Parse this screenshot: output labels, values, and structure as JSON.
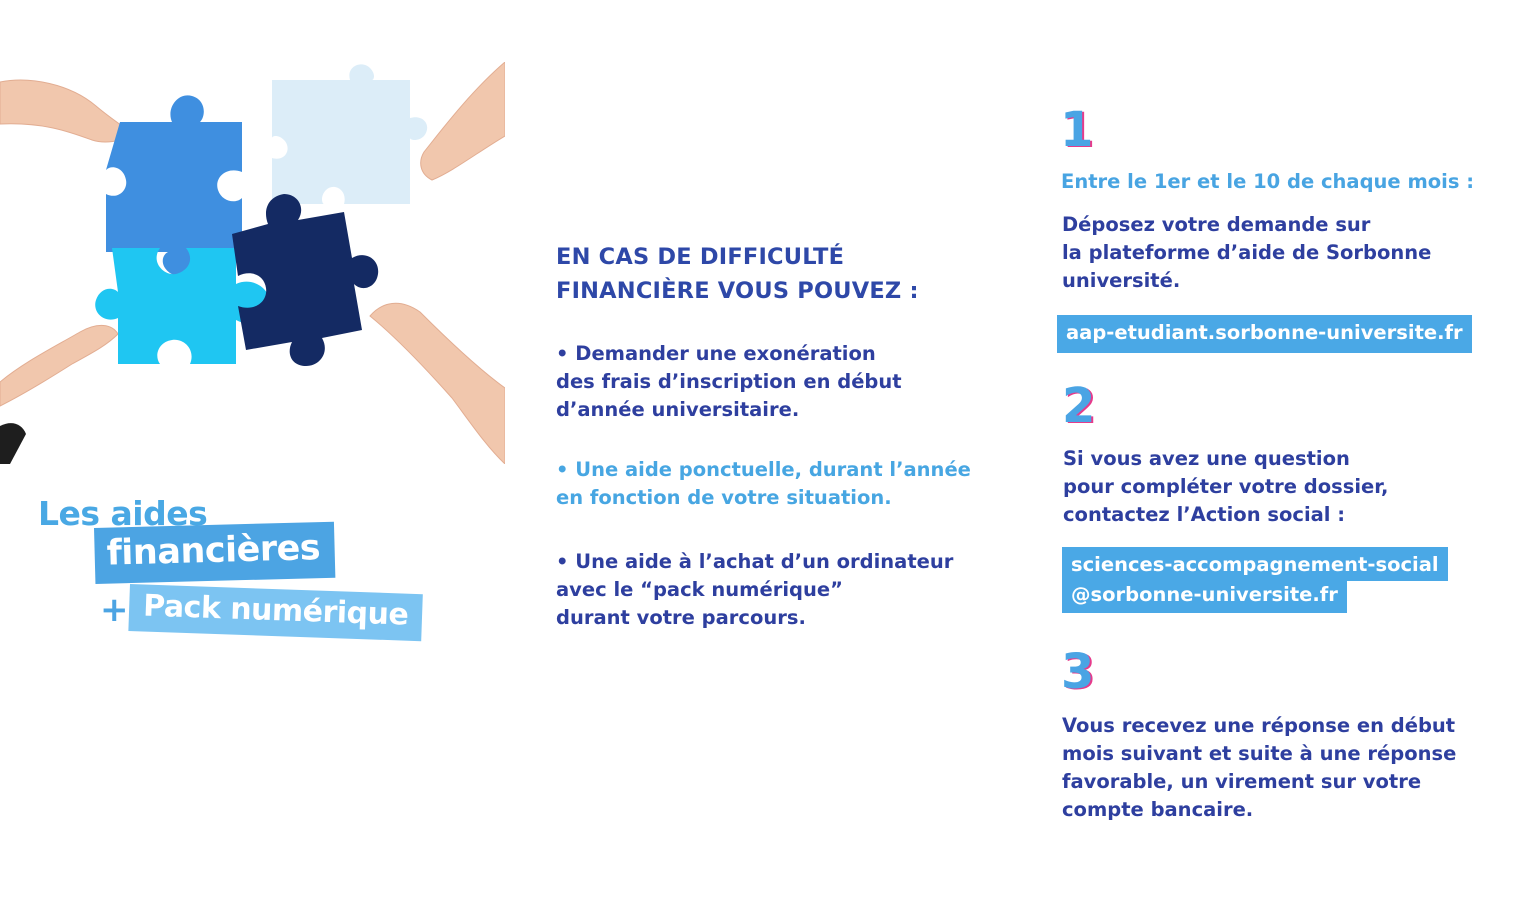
{
  "colors": {
    "dark_blue": "#2e3f9f",
    "light_blue": "#48a4e2",
    "accent_pink": "#e63b8b",
    "puzzle_blue": "#3f8fe0",
    "puzzle_pale": "#dcedf8",
    "puzzle_cyan": "#1fc6f2",
    "puzzle_navy": "#142a63"
  },
  "title": {
    "line1": "Les aides",
    "line2": "financières",
    "plus": "+",
    "line3": "Pack numérique"
  },
  "middle": {
    "heading_line1": "EN CAS DE DIFFICULTÉ",
    "heading_line2": "FINANCIÈRE VOUS POUVEZ :",
    "bullets": [
      {
        "lines": [
          "• Demander une exonération",
          "des frais d’inscription en début",
          "d’année universitaire."
        ]
      },
      {
        "lines": [
          "• Une aide ponctuelle, durant l’année",
          "en fonction de votre situation."
        ]
      },
      {
        "lines": [
          "• Une aide à l’achat d’un ordinateur",
          "avec le “pack numérique”",
          "durant votre parcours."
        ]
      }
    ]
  },
  "steps": [
    {
      "number": "1",
      "subtitle": "Entre le 1er et le 10 de chaque mois :",
      "lines": [
        "Déposez votre demande sur",
        "la plateforme d’aide de Sorbonne",
        "université."
      ],
      "link": "aap-etudiant.sorbonne-universite.fr"
    },
    {
      "number": "2",
      "lines": [
        "Si vous avez une question",
        "pour compléter votre dossier,",
        "contactez l’Action social :"
      ],
      "link_line1": "sciences-accompagnement-social",
      "link_line2": "@sorbonne-universite.fr"
    },
    {
      "number": "3",
      "lines": [
        "Vous recevez une réponse en début",
        "mois suivant et suite à une réponse",
        "favorable, un virement sur votre",
        "compte bancaire."
      ]
    }
  ]
}
